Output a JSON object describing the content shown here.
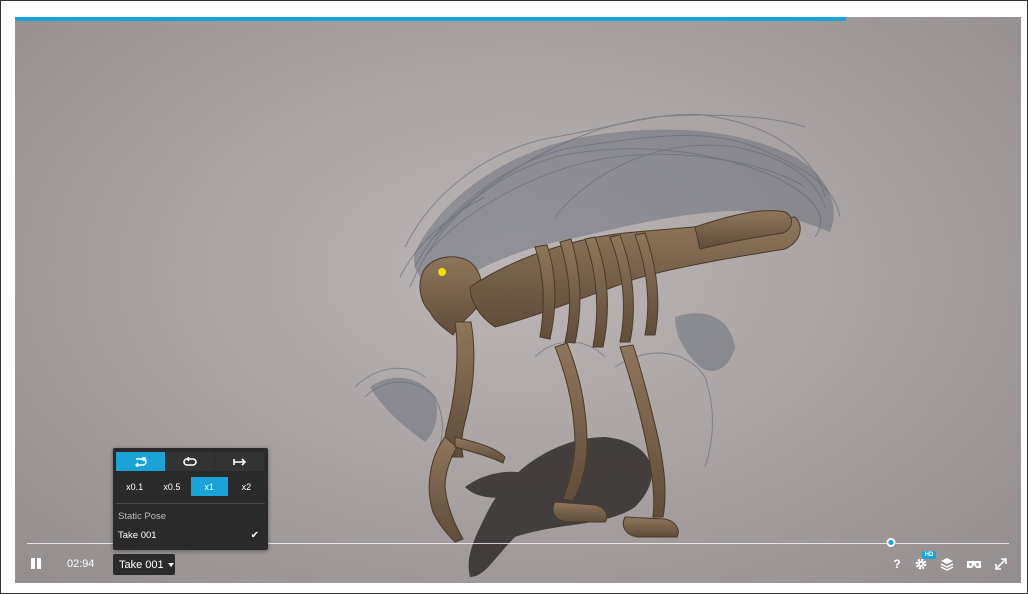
{
  "viewer": {
    "loading_progress_percent": 82.6,
    "accent_color": "#1aa3d9",
    "background_color": "#aaa3a3"
  },
  "controls": {
    "time": "02:94",
    "timeline_progress_fraction": 0.88,
    "animation_select_label": "Take 001",
    "hd_badge": "HD",
    "help_label": "?"
  },
  "animation_menu": {
    "modes": [
      {
        "icon": "loop-one-icon",
        "active": true
      },
      {
        "icon": "loop-all-icon",
        "active": false
      },
      {
        "icon": "play-once-icon",
        "active": false
      }
    ],
    "speeds": [
      "x0.1",
      "x0.5",
      "x1",
      "x2"
    ],
    "active_speed": "x1",
    "items": [
      "Static Pose",
      "Take 001"
    ],
    "selected_item": "Take 001"
  }
}
